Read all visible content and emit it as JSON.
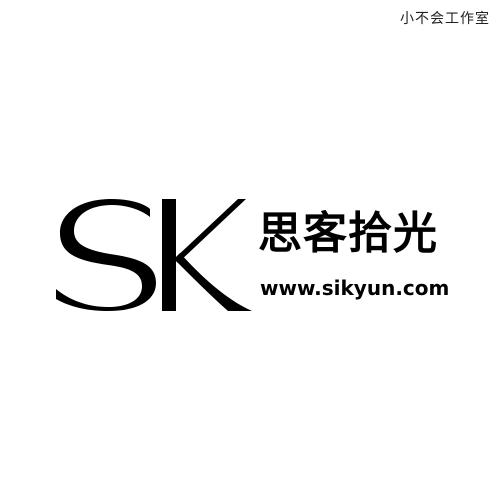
{
  "studio_label": "小不会工作室",
  "logo": {
    "monogram": "SK",
    "name": "思客拾光",
    "url": "www.sikyun.com"
  },
  "colors": {
    "background": "#ffffff",
    "ink": "#000000"
  }
}
